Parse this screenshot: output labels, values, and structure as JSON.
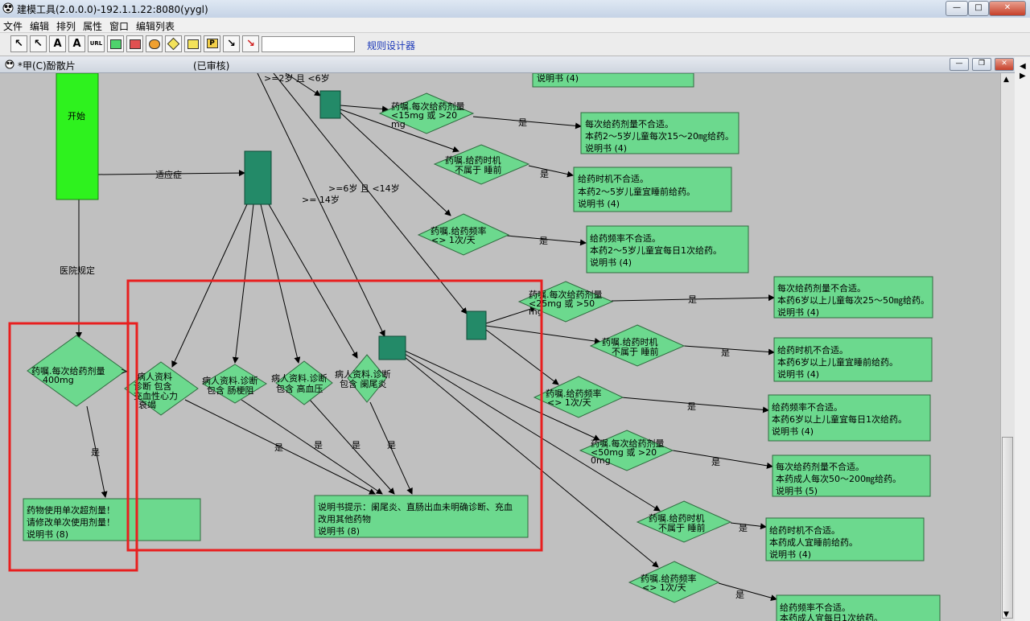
{
  "window": {
    "title": "建模工具(2.0.0.0)-192.1.1.22:8080(yygl)",
    "minimize": "—",
    "maximize": "□",
    "close": "✕"
  },
  "menu": [
    "文件",
    "编辑",
    "排列",
    "属性",
    "窗口",
    "编辑列表"
  ],
  "toolbar": {
    "tools": [
      {
        "name": "pointer-tool",
        "glyph": "↖"
      },
      {
        "name": "select-tool",
        "glyph": "↖"
      },
      {
        "name": "text-tool",
        "glyph": "A"
      },
      {
        "name": "text-style-tool",
        "glyph": "A"
      },
      {
        "name": "bold-text-tool",
        "glyph": "A"
      },
      {
        "name": "url-tool",
        "glyph": "URL"
      },
      {
        "name": "green-box-tool",
        "glyph": "box"
      },
      {
        "name": "red-box-tool",
        "glyph": "box"
      },
      {
        "name": "condition-tool",
        "glyph": "Q"
      },
      {
        "name": "diamond-tool",
        "glyph": "dia"
      },
      {
        "name": "yellow-box-tool",
        "glyph": "box"
      },
      {
        "name": "p-box-tool",
        "glyph": "P"
      },
      {
        "name": "arrow-tool",
        "glyph": "↘"
      },
      {
        "name": "red-arrow-tool",
        "glyph": "↘"
      }
    ],
    "link": "规则设计器",
    "input_value": ""
  },
  "doc": {
    "title": "*甲(C)酚散片",
    "status": "(已审核)"
  },
  "colors": {
    "start": "#2ef21e",
    "junction": "#238a68",
    "node_fill": "#6cd98e",
    "highlight": "#e81f1f"
  },
  "flow": {
    "start": "开始",
    "edge_labels": {
      "indication": "适应症",
      "hospital": "医院规定",
      "age_2_6": ">=2岁 且 <6岁",
      "age_6_14": ">=6岁 且 <14岁",
      "age_14": ">= 14岁",
      "yes": "是"
    },
    "diamonds": {
      "d_2_6_dose": [
        "药嘱.每次给药剂量",
        "<15mg 或 >20",
        "mg"
      ],
      "d_2_6_time": [
        "药嘱.给药时机",
        "不属于 睡前"
      ],
      "d_2_6_freq": [
        "药嘱.给药频率",
        "<> 1次/天"
      ],
      "d_6_14_dose": [
        "药嘱.每次给药剂量",
        "<25mg 或 >50",
        "mg"
      ],
      "d_6_14_time": [
        "药嘱.给药时机",
        "不属于 睡前"
      ],
      "d_6_14_freq": [
        "药嘱.给药频率",
        "<> 1次/天"
      ],
      "d_adult_dose": [
        "药嘱.每次给药剂量",
        "<50mg 或 >20",
        "0mg"
      ],
      "d_adult_time": [
        "药嘱.给药时机",
        "不属于 睡前"
      ],
      "d_adult_freq": [
        "药嘱.给药频率",
        "<> 1次/天"
      ],
      "d_hosp": [
        "药嘱.每次给药剂量",
        ">",
        "400mg"
      ],
      "d_heart": [
        "病人资料",
        "诊断 包含",
        "充血性心力",
        "衰竭"
      ],
      "d_bowel": [
        "病人资料.诊断",
        "包含 肠梗阻"
      ],
      "d_bp": [
        "病人资料.诊断",
        "包含 高血压"
      ],
      "d_appendix": [
        "病人资料.诊断",
        "包含 阑尾炎"
      ]
    },
    "boxes": {
      "b_top": [
        "说明书  (4)"
      ],
      "b_2_6_dose": [
        "每次给药剂量不合适。",
        "本药2～5岁儿童每次15～20㎎给药。",
        "说明书  (4)"
      ],
      "b_2_6_time": [
        "给药时机不合适。",
        "本药2～5岁儿童宜睡前给药。",
        "说明书  (4)"
      ],
      "b_2_6_freq": [
        "给药频率不合适。",
        "本药2～5岁儿童宜每日1次给药。",
        "说明书  (4)"
      ],
      "b_6_14_dose": [
        "每次给药剂量不合适。",
        "本药6岁以上儿童每次25～50㎎给药。",
        "说明书  (4)"
      ],
      "b_6_14_time": [
        "给药时机不合适。",
        "本药6岁以上儿童宜睡前给药。",
        "说明书  (4)"
      ],
      "b_6_14_freq": [
        "给药频率不合适。",
        "本药6岁以上儿童宜每日1次给药。",
        "说明书  (4)"
      ],
      "b_adult_dose": [
        "每次给药剂量不合适。",
        "本药成人每次50～200㎎给药。",
        "说明书  (5)"
      ],
      "b_adult_time": [
        "给药时机不合适。",
        "本药成人宜睡前给药。",
        "说明书  (4)"
      ],
      "b_adult_freq": [
        "给药频率不合适。",
        "本药成人宜每日1次给药。"
      ],
      "b_hosp": [
        "药物使用单次超剂量！",
        "请修改单次使用剂量！",
        "说明书  (8)"
      ],
      "b_contra": [
        "说明书提示：阑尾炎、直肠出血未明确诊断、充血",
        "改用其他药物",
        "说明书  (8)"
      ]
    }
  }
}
